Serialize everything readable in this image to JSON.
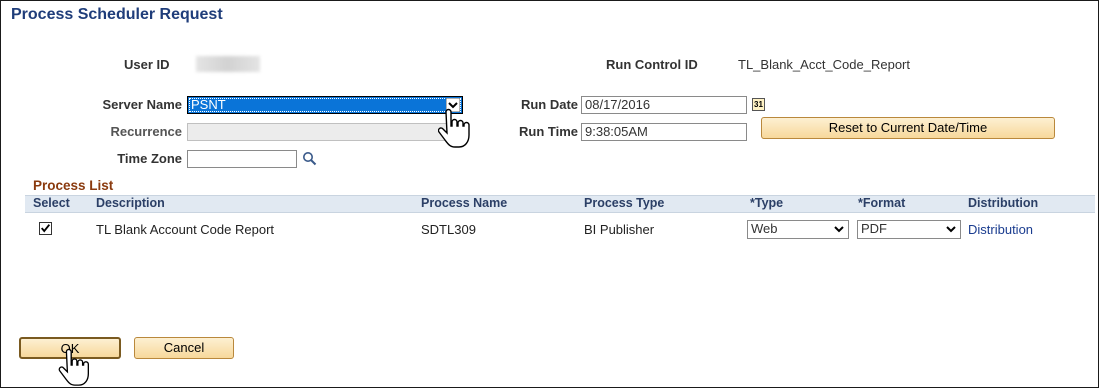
{
  "page_title": "Process Scheduler Request",
  "header": {
    "user_id_label": "User ID",
    "run_control_label": "Run Control ID",
    "run_control_value": "TL_Blank_Acct_Code_Report"
  },
  "form": {
    "server_name_label": "Server Name",
    "server_name_value": "PSNT",
    "recurrence_label": "Recurrence",
    "recurrence_value": "",
    "time_zone_label": "Time Zone",
    "time_zone_value": "",
    "run_date_label": "Run Date",
    "run_date_value": "08/17/2016",
    "run_time_label": "Run Time",
    "run_time_value": "9:38:05AM",
    "reset_button": "Reset to Current Date/Time",
    "calendar_icon_text": "31"
  },
  "process_list": {
    "title": "Process List",
    "columns": {
      "select": "Select",
      "description": "Description",
      "process_name": "Process Name",
      "process_type": "Process Type",
      "type": "*Type",
      "format": "*Format",
      "distribution": "Distribution"
    },
    "rows": [
      {
        "selected": true,
        "description": "TL Blank Account Code Report",
        "process_name": "SDTL309",
        "process_type": "BI Publisher",
        "type": "Web",
        "format": "PDF",
        "distribution": "Distribution"
      }
    ]
  },
  "buttons": {
    "ok": "OK",
    "cancel": "Cancel"
  },
  "colors": {
    "title": "#1f3d7a",
    "section_title": "#8a3a0e",
    "selection": "#0a74d8",
    "button_fill": "#f7d89b",
    "grid_header": "#e1e9f2"
  }
}
